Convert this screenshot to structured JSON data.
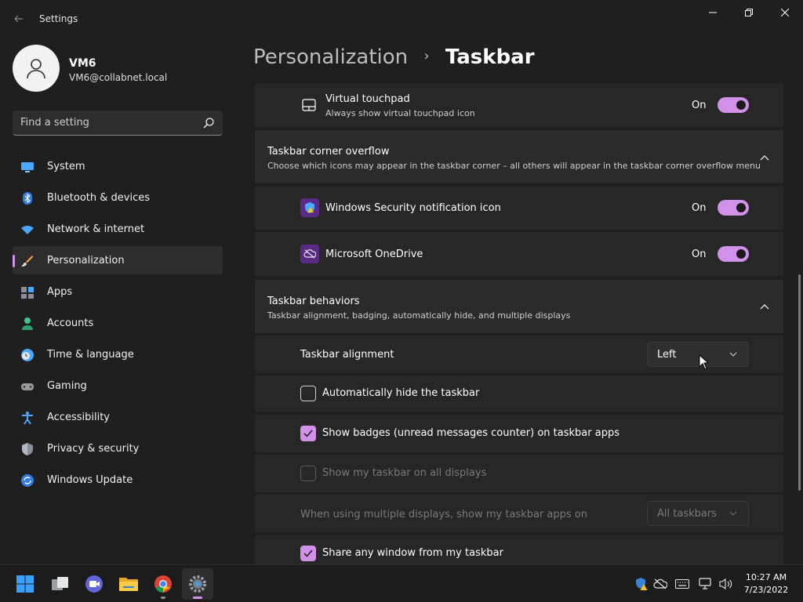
{
  "window": {
    "title": "Settings"
  },
  "profile": {
    "name": "VM6",
    "email": "VM6@collabnet.local"
  },
  "search": {
    "placeholder": "Find a setting"
  },
  "nav": [
    {
      "label": "System",
      "icon": "monitor-icon"
    },
    {
      "label": "Bluetooth & devices",
      "icon": "bluetooth-icon"
    },
    {
      "label": "Network & internet",
      "icon": "wifi-icon"
    },
    {
      "label": "Personalization",
      "icon": "brush-icon",
      "selected": true
    },
    {
      "label": "Apps",
      "icon": "apps-icon"
    },
    {
      "label": "Accounts",
      "icon": "person-icon"
    },
    {
      "label": "Time & language",
      "icon": "clock-globe-icon"
    },
    {
      "label": "Gaming",
      "icon": "gamepad-icon"
    },
    {
      "label": "Accessibility",
      "icon": "accessibility-icon"
    },
    {
      "label": "Privacy & security",
      "icon": "shield-icon"
    },
    {
      "label": "Windows Update",
      "icon": "update-icon"
    }
  ],
  "breadcrumb": {
    "parent": "Personalization",
    "separator": "›",
    "current": "Taskbar"
  },
  "touchpad": {
    "title": "Virtual touchpad",
    "desc": "Always show virtual touchpad icon",
    "state": "On"
  },
  "corner_overflow": {
    "title": "Taskbar corner overflow",
    "desc": "Choose which icons may appear in the taskbar corner – all others will appear in the taskbar corner overflow menu",
    "items": [
      {
        "label": "Windows Security notification icon",
        "state": "On"
      },
      {
        "label": "Microsoft OneDrive",
        "state": "On"
      }
    ]
  },
  "behaviors": {
    "title": "Taskbar behaviors",
    "desc": "Taskbar alignment, badging, automatically hide, and multiple displays",
    "alignment_label": "Taskbar alignment",
    "alignment_value": "Left",
    "auto_hide": "Automatically hide the taskbar",
    "badges": "Show badges (unread messages counter) on taskbar apps",
    "all_displays": "Show my taskbar on all displays",
    "multi_label": "When using multiple displays, show my taskbar apps on",
    "multi_value": "All taskbars",
    "share": "Share any window from my taskbar"
  },
  "clock": {
    "time": "10:27 AM",
    "date": "7/23/2022"
  },
  "colors": {
    "accent": "#d291e9",
    "background": "#1f1f1f",
    "card": "#2b2b2b"
  }
}
